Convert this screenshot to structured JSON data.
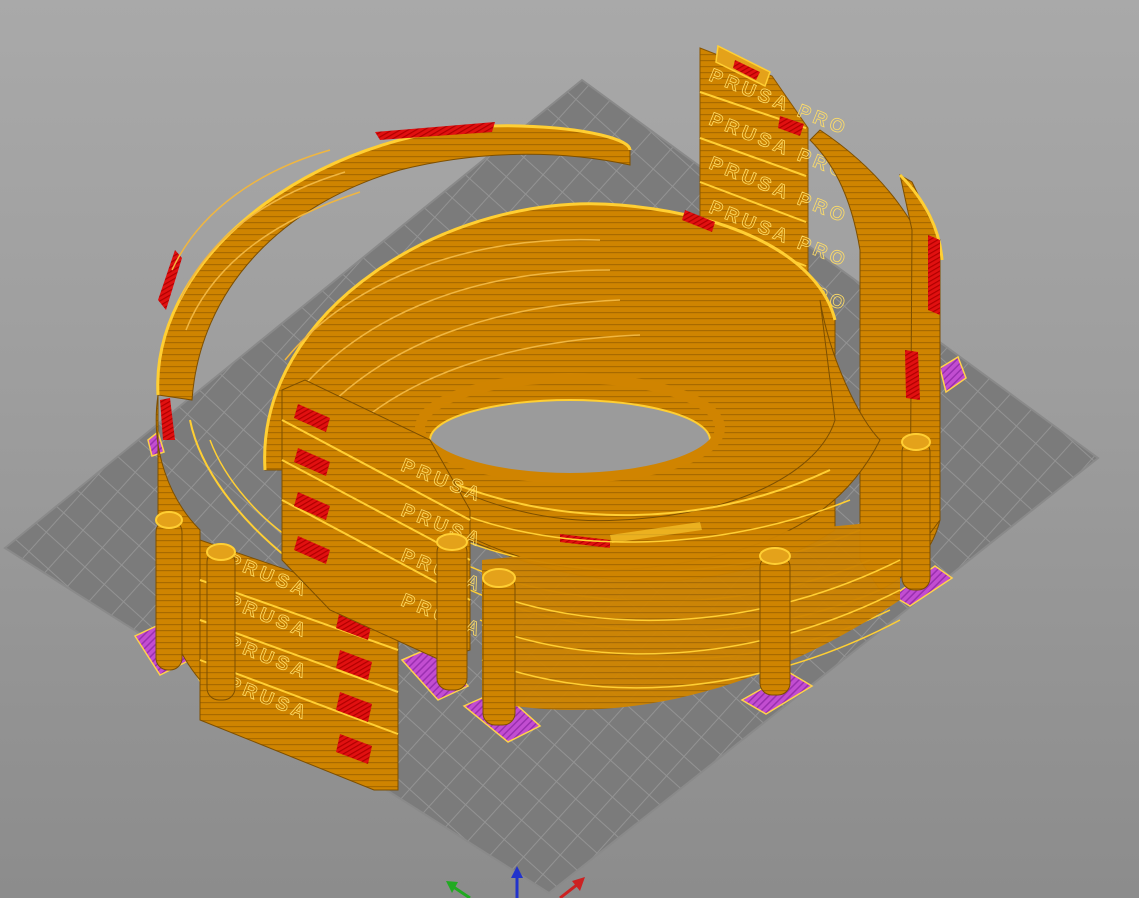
{
  "viewer": {
    "view_mode": "3D preview",
    "bed_grid": "on",
    "emboss_texts": {
      "left_stack": [
        "PRUSA",
        "PRUSA",
        "PRUSA",
        "PRUSA"
      ],
      "front_stack": [
        "PRUSA",
        "PRUSA",
        "PRUSA",
        "PRUSA"
      ],
      "back_stack": [
        "PRUSA PRO",
        "PRUSA PRO",
        "PRUSA PRO",
        "PRUSA PRO",
        "PRUSA PRO"
      ]
    },
    "colors": {
      "background_top": "#a9a9a9",
      "background_bottom": "#8c8c8c",
      "bed": "#7b7b7b",
      "bed_grid": "#8f8f8f",
      "perimeter": "#d08400",
      "perimeter_highlight": "#ffcf33",
      "infill": "#e11010",
      "support": "#c24dd1",
      "axis_x": "#cc2222",
      "axis_y": "#22aa22",
      "axis_z": "#2233cc"
    },
    "axes": [
      "x-axis",
      "y-axis",
      "z-axis"
    ]
  }
}
